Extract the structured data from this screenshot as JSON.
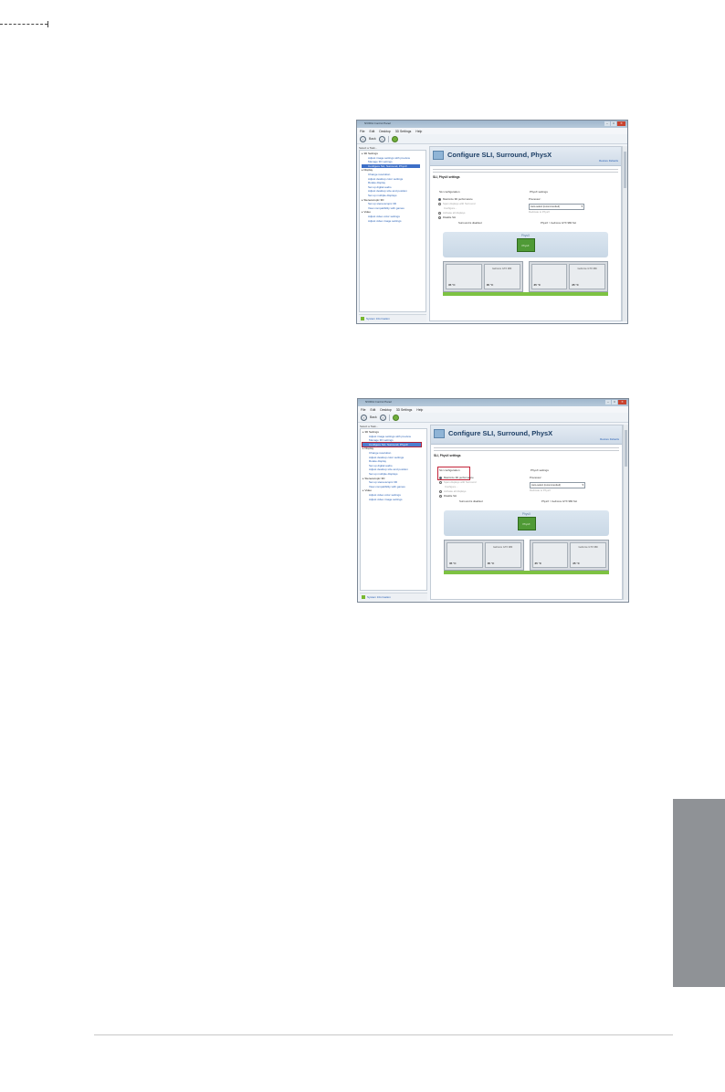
{
  "window": {
    "title": "NVIDIA Control Panel",
    "controls": [
      "–",
      "□",
      "✕"
    ]
  },
  "menu": [
    "File",
    "Edit",
    "Desktop",
    "3D Settings",
    "Help"
  ],
  "toolbar": {
    "back_label": "Back",
    "icons": [
      "back-icon",
      "forward-icon",
      "home-icon"
    ],
    "back_glyph": "‹",
    "forward_glyph": "›"
  },
  "nav": {
    "task_label": "Select a Task...",
    "tree": [
      {
        "label": "3D Settings",
        "children": [
          "Adjust image settings with preview",
          "Manage 3D settings",
          "Configure SLI, Surround, PhysX"
        ]
      },
      {
        "label": "Display",
        "children": [
          "Change resolution",
          "Adjust desktop color settings",
          "Rotate display",
          "Set up digital audio",
          "Adjust desktop size and position",
          "Set up multiple displays"
        ]
      },
      {
        "label": "Stereoscopic 3D",
        "children": [
          "Set up stereoscopic 3D",
          "View compatibility with games"
        ]
      },
      {
        "label": "Video",
        "children": [
          "Adjust video color settings",
          "Adjust video image settings"
        ]
      }
    ],
    "system_info": "System Information"
  },
  "content": {
    "title": "Configure SLI, Surround, PhysX",
    "restore_defaults": "Restore Defaults",
    "section_label": "SLI, PhysX settings",
    "sli_configuration": {
      "label": "SLI configuration",
      "options": [
        "Maximize 3D performance",
        "Span displays with Surround",
        "Configure...",
        "Activate all displays",
        "Disable SLI"
      ]
    },
    "physx": {
      "label": "PhysX settings",
      "processor_label": "Processor:",
      "processor_value": "Auto-select (recommended)",
      "checkbox": "Dedicate to PhysX"
    },
    "status_left": "Surround is disabled",
    "status_right": "PhysX > GeForce GTX 980 SLI",
    "diagram": {
      "physx_label": "PhysX",
      "chip_label": "PhysX",
      "gpu_labels": [
        "GeForce GTX 980",
        "GeForce GTX 980"
      ],
      "temps": [
        "35 °C",
        "35 °C",
        "35 °C",
        "35 °C"
      ]
    }
  },
  "colors": {
    "nvidia_green": "#77b82f",
    "highlight_outline": "#c3243a",
    "side_tab": "#8f9296"
  }
}
